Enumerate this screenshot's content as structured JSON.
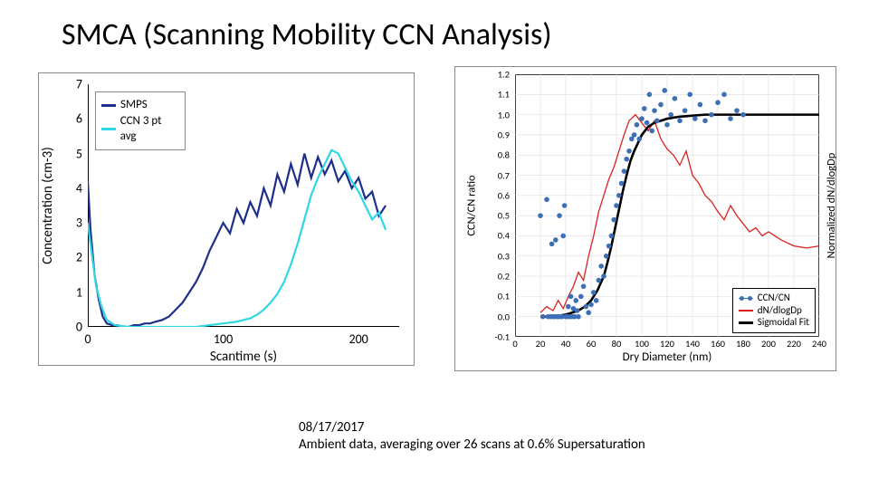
{
  "title": "SMCA (Scanning Mobility CCN Analysis)",
  "caption_line1": "08/17/2017",
  "caption_line2": "Ambient data, averaging over 26 scans at 0.6% Supersaturation",
  "chart_data": [
    {
      "id": "left",
      "type": "line",
      "xlabel": "Scantime (s)",
      "ylabel": "Concentration (cm-3)",
      "xlim": [
        0,
        230
      ],
      "ylim": [
        0,
        7
      ],
      "xticks": [
        0,
        100,
        200
      ],
      "yticks": [
        0,
        1,
        2,
        3,
        4,
        5,
        6,
        7
      ],
      "legend": [
        "SMPS",
        "CCN 3 pt avg"
      ],
      "colors": {
        "SMPS": "#1d2e8b",
        "CCN 3 pt avg": "#2fd7e4"
      },
      "series": [
        {
          "name": "SMPS",
          "x": [
            0,
            2,
            5,
            8,
            11,
            14,
            18,
            22,
            26,
            30,
            34,
            38,
            42,
            46,
            50,
            55,
            60,
            65,
            70,
            75,
            80,
            85,
            90,
            95,
            100,
            105,
            110,
            115,
            120,
            125,
            130,
            135,
            140,
            145,
            150,
            155,
            160,
            165,
            170,
            175,
            180,
            185,
            190,
            195,
            200,
            205,
            210,
            215,
            220
          ],
          "y": [
            4.2,
            2.8,
            1.5,
            0.8,
            0.3,
            0.1,
            0.05,
            0.05,
            0,
            0,
            0.05,
            0.05,
            0.1,
            0.1,
            0.15,
            0.2,
            0.3,
            0.5,
            0.7,
            1.0,
            1.3,
            1.7,
            2.2,
            2.6,
            3.0,
            2.7,
            3.4,
            3.0,
            3.6,
            3.2,
            4.0,
            3.5,
            4.4,
            3.9,
            4.7,
            4.1,
            5.0,
            4.3,
            4.9,
            4.4,
            4.8,
            4.2,
            4.5,
            4.0,
            4.3,
            3.7,
            3.9,
            3.2,
            3.5
          ]
        },
        {
          "name": "CCN 3 pt avg",
          "x": [
            0,
            3,
            6,
            10,
            14,
            20,
            30,
            40,
            50,
            60,
            70,
            80,
            90,
            100,
            110,
            120,
            125,
            130,
            135,
            140,
            145,
            150,
            155,
            160,
            165,
            170,
            175,
            180,
            185,
            190,
            195,
            200,
            205,
            210,
            215,
            220
          ],
          "y": [
            3.0,
            2.1,
            1.2,
            0.6,
            0.2,
            0.05,
            0,
            0,
            0,
            0,
            0,
            0,
            0.05,
            0.1,
            0.15,
            0.25,
            0.35,
            0.5,
            0.7,
            0.95,
            1.3,
            1.8,
            2.4,
            3.1,
            3.8,
            4.3,
            4.7,
            5.1,
            5.0,
            4.6,
            4.2,
            3.9,
            3.5,
            3.1,
            3.3,
            2.8
          ]
        }
      ]
    },
    {
      "id": "right",
      "type": "scatter+line",
      "xlabel": "Dry Diameter (nm)",
      "ylabel_left": "CCN/CN ratio",
      "ylabel_right": "Normalized dN/dlogDp",
      "xlim": [
        0,
        240
      ],
      "ylim": [
        -0.1,
        1.2
      ],
      "xticks": [
        0,
        20,
        40,
        60,
        80,
        100,
        120,
        140,
        160,
        180,
        200,
        220,
        240
      ],
      "yticks": [
        -0.1,
        0.0,
        0.1,
        0.2,
        0.3,
        0.4,
        0.5,
        0.6,
        0.7,
        0.8,
        0.9,
        1.0,
        1.1,
        1.2
      ],
      "legend": [
        "CCN/CN",
        "dN/dlogDp",
        "Sigmoidal Fit"
      ],
      "colors": {
        "CCN/CN": "#3d6fb6",
        "dN/dlogDp": "#d9221f",
        "Sigmoidal Fit": "#000000"
      },
      "series": [
        {
          "name": "dN/dlogDp",
          "kind": "line",
          "x": [
            20,
            25,
            30,
            34,
            38,
            42,
            46,
            50,
            54,
            58,
            62,
            66,
            70,
            74,
            78,
            82,
            86,
            90,
            95,
            100,
            105,
            110,
            115,
            120,
            125,
            130,
            135,
            140,
            145,
            150,
            155,
            160,
            165,
            170,
            175,
            180,
            185,
            190,
            195,
            200,
            210,
            220,
            230,
            240
          ],
          "y": [
            0.02,
            0.05,
            0.03,
            0.08,
            0.04,
            0.1,
            0.15,
            0.22,
            0.18,
            0.3,
            0.4,
            0.52,
            0.6,
            0.68,
            0.74,
            0.82,
            0.9,
            0.97,
            1.0,
            0.96,
            0.92,
            0.97,
            0.88,
            0.83,
            0.8,
            0.75,
            0.82,
            0.7,
            0.66,
            0.6,
            0.57,
            0.52,
            0.48,
            0.55,
            0.5,
            0.46,
            0.42,
            0.44,
            0.4,
            0.42,
            0.38,
            0.35,
            0.34,
            0.35
          ]
        },
        {
          "name": "Sigmoidal Fit",
          "kind": "line",
          "x": [
            20,
            30,
            40,
            50,
            55,
            60,
            65,
            70,
            73,
            76,
            79,
            82,
            85,
            88,
            91,
            94,
            97,
            100,
            105,
            110,
            120,
            130,
            150,
            180,
            220,
            240
          ],
          "y": [
            0.0,
            0.0,
            0.01,
            0.03,
            0.05,
            0.08,
            0.13,
            0.2,
            0.27,
            0.35,
            0.44,
            0.53,
            0.62,
            0.7,
            0.77,
            0.82,
            0.86,
            0.9,
            0.94,
            0.96,
            0.98,
            0.99,
            1.0,
            1.0,
            1.0,
            1.0
          ]
        },
        {
          "name": "CCN/CN",
          "kind": "scatter",
          "x": [
            20,
            22,
            25,
            26,
            28,
            29,
            30,
            31,
            32,
            33,
            34,
            35,
            36,
            37,
            38,
            39,
            40,
            41,
            42,
            43,
            44,
            45,
            46,
            47,
            48,
            49,
            50,
            52,
            54,
            56,
            58,
            60,
            62,
            64,
            66,
            68,
            70,
            72,
            74,
            76,
            78,
            80,
            82,
            84,
            86,
            88,
            90,
            92,
            94,
            96,
            98,
            100,
            102,
            104,
            106,
            108,
            110,
            112,
            115,
            118,
            120,
            123,
            126,
            130,
            134,
            138,
            142,
            146,
            150,
            155,
            160,
            165,
            170,
            175,
            180
          ],
          "y": [
            0.5,
            0.0,
            0.58,
            0.0,
            0.0,
            0.36,
            0.0,
            0.0,
            0.38,
            0.0,
            0.0,
            0.5,
            0.0,
            0.0,
            0.4,
            0.55,
            0.0,
            0.0,
            0.05,
            0.0,
            0.1,
            0.0,
            0.04,
            0.0,
            0.08,
            0.03,
            0.0,
            0.1,
            0.15,
            0.05,
            0.02,
            0.06,
            0.12,
            0.08,
            0.18,
            0.25,
            0.2,
            0.3,
            0.35,
            0.4,
            0.48,
            0.55,
            0.6,
            0.66,
            0.72,
            0.78,
            0.82,
            0.88,
            0.9,
            0.95,
            0.88,
            0.98,
            1.03,
            0.96,
            1.1,
            0.92,
            1.02,
            0.97,
            1.05,
            1.12,
            0.95,
            1.0,
            1.08,
            0.97,
            1.02,
            1.1,
            0.98,
            1.05,
            0.97,
            1.0,
            1.06,
            1.1,
            0.98,
            1.02,
            1.0
          ]
        }
      ]
    }
  ]
}
